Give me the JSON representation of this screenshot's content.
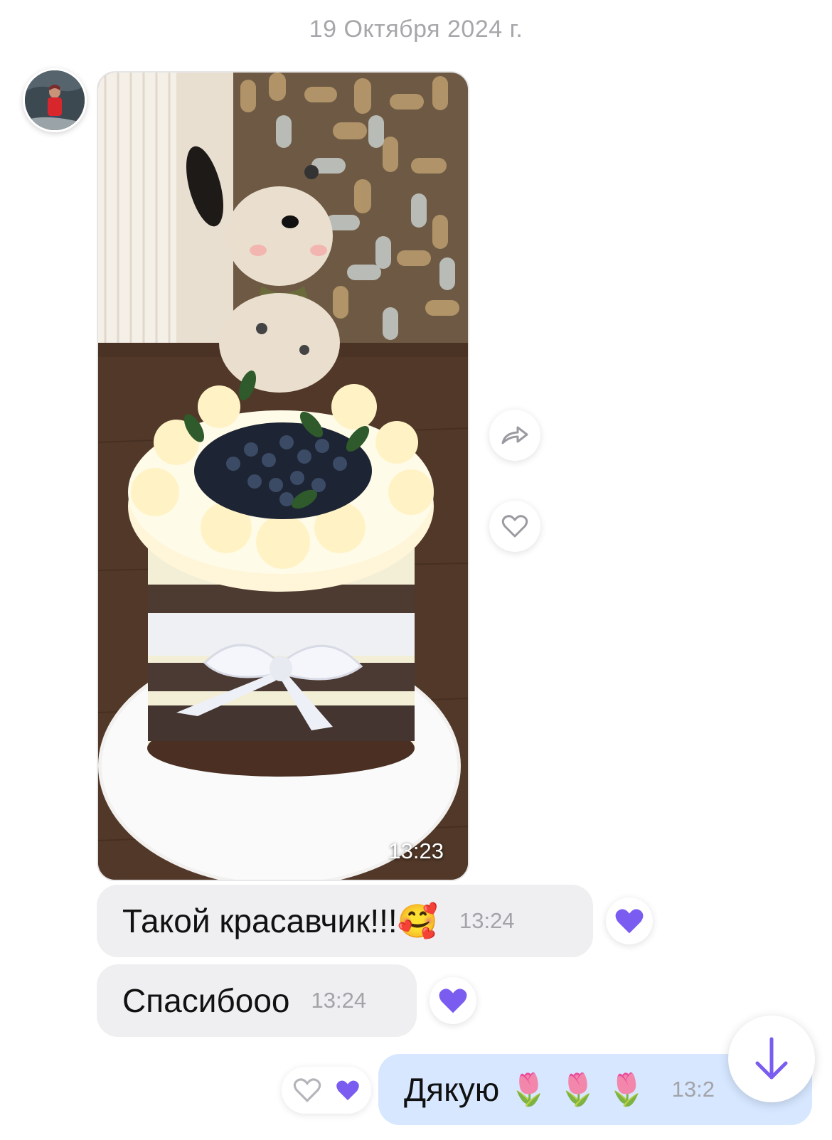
{
  "date_separator": "19 Октября 2024 г.",
  "incoming_photo": {
    "time": "13:23"
  },
  "messages_in": [
    {
      "text": "Такой красавчик!!!🥰",
      "time": "13:24",
      "reaction": "heart-filled"
    },
    {
      "text": "Спасибооо",
      "time": "13:24",
      "reaction": "heart-filled"
    }
  ],
  "message_out": {
    "text": "Дякую",
    "emoji": [
      "🌷",
      "🌷",
      "🌷"
    ],
    "time": "13:2"
  },
  "colors": {
    "accent": "#7b5cf0",
    "incoming_bubble": "#efeff2",
    "outgoing_bubble": "#d6e7ff",
    "muted_text": "#a3a3a8"
  },
  "icons": {
    "forward": "forward-icon",
    "like": "heart-outline-icon",
    "reaction": "heart-filled-icon",
    "scroll": "arrow-down-icon"
  }
}
